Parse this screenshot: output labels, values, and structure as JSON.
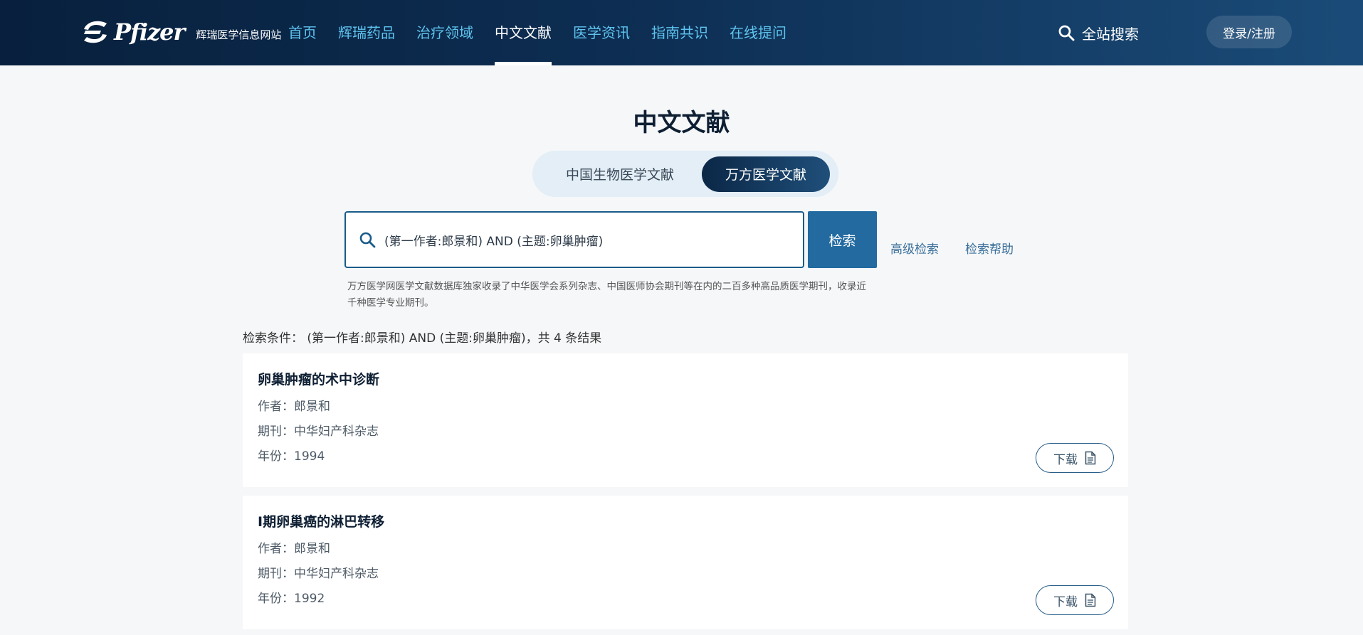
{
  "header": {
    "logo_word": "Pfizer",
    "logo_sub": "辉瑞医学信息网站",
    "nav": [
      {
        "label": "首页"
      },
      {
        "label": "辉瑞药品"
      },
      {
        "label": "治疗领域"
      },
      {
        "label": "中文文献"
      },
      {
        "label": "医学资讯"
      },
      {
        "label": "指南共识"
      },
      {
        "label": "在线提问"
      }
    ],
    "active_nav": "中文文献",
    "site_search_label": "全站搜索",
    "login_label": "登录/注册"
  },
  "page_title": "中文文献",
  "tabs": [
    {
      "label": "中国生物医学文献"
    },
    {
      "label": "万方医学文献"
    }
  ],
  "active_tab": "万方医学文献",
  "search": {
    "value": "(第一作者:郎景和) AND (主题:卵巢肿瘤)",
    "button_label": "检索",
    "advanced_label": "高级检索",
    "help_label": "检索帮助",
    "description": "万方医学网医学文献数据库独家收录了中华医学会系列杂志、中国医师协会期刊等在内的二百多种高品质医学期刊，收录近千种医学专业期刊。"
  },
  "summary": "检索条件： (第一作者:郎景和) AND (主题:卵巢肿瘤)，共 4 条结果",
  "results": [
    {
      "title": "卵巢肿瘤的术中诊断",
      "author": "作者：郎景和",
      "journal": "期刊：中华妇产科杂志",
      "year": "年份：1994",
      "download_label": "下载"
    },
    {
      "title": "Ⅰ期卵巢癌的淋巴转移",
      "author": "作者：郎景和",
      "journal": "期刊：中华妇产科杂志",
      "year": "年份：1992",
      "download_label": "下载"
    }
  ],
  "colors": {
    "header_start": "#08203d",
    "header_end": "#1a4b78",
    "nav_link": "#5fc4ef",
    "accent_button": "#226aa0"
  }
}
